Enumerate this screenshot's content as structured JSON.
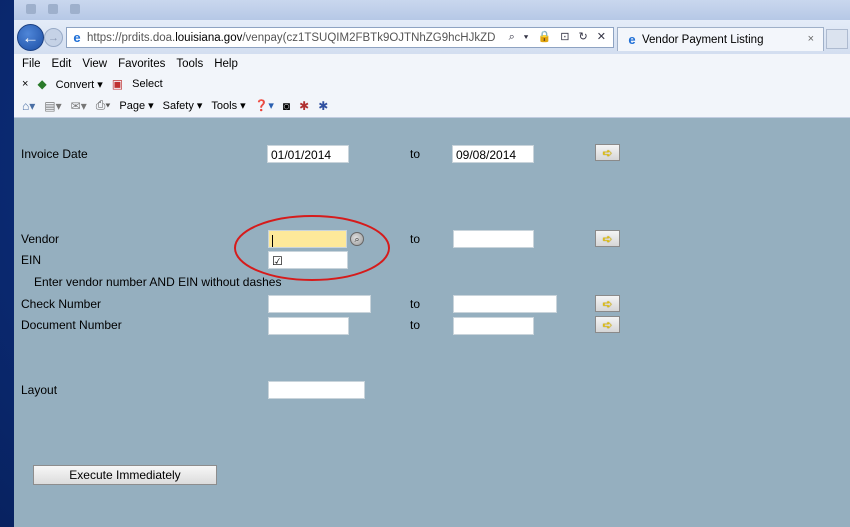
{
  "browser": {
    "url_prefix": "https://prdits.doa.",
    "url_domain": "louisiana.gov",
    "url_suffix": "/venpay(cz1TSUQIM2FBTk9OJTNhZG9hcHJkZD",
    "address_actions": "⌕ ▾ 🔒 ⊡ ↻ ✕",
    "tab_title": "Vendor Payment Listing",
    "tab_close": "×"
  },
  "menu": [
    "File",
    "Edit",
    "View",
    "Favorites",
    "Tools",
    "Help"
  ],
  "toolbar1": {
    "close": "×",
    "convert": "Convert ▾",
    "select": "Select"
  },
  "toolbar2": {
    "page": "Page ▾",
    "safety": "Safety ▾",
    "tools": "Tools ▾",
    "help": "❓▾"
  },
  "form": {
    "invoice_date_label": "Invoice Date",
    "invoice_from": "01/01/2014",
    "to_label": "to",
    "invoice_to": "09/08/2014",
    "vendor_label": "Vendor",
    "vendor_value": "",
    "vendor_to": "",
    "ein_label": "EIN",
    "ein_value": "☑",
    "hint": "Enter vendor number AND EIN without dashes",
    "check_label": "Check Number",
    "check_from": "",
    "check_to": "",
    "doc_label": "Document Number",
    "doc_from": "",
    "doc_to": "",
    "layout_label": "Layout",
    "layout_value": "",
    "execute_button": "Execute Immediately",
    "arrow_glyph": "➪"
  },
  "colors": {
    "content_bg": "#95afbf",
    "highlight_field": "#fde99a",
    "annotation_ellipse": "#d61b1b"
  }
}
